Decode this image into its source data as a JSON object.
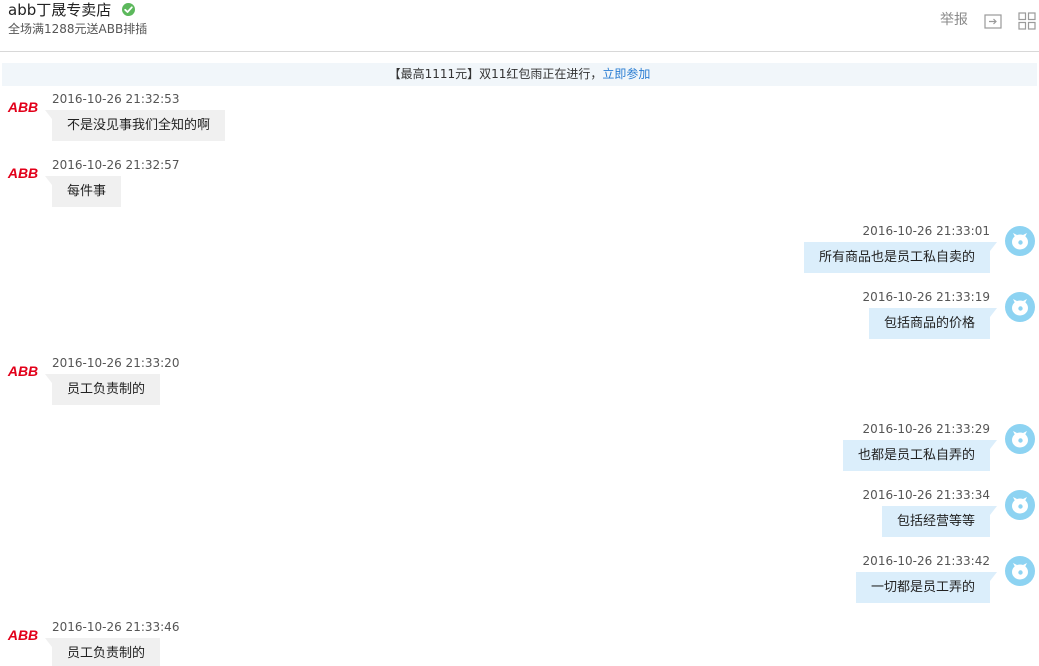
{
  "header": {
    "shop_name": "abb丁晟专卖店",
    "subtitle": "全场满1288元送ABB排插",
    "report_label": "举报",
    "verified_color": "#5cb85c"
  },
  "promo": {
    "text": "【最高1111元】双11红包雨正在进行，",
    "link_text": "立即参加",
    "link_color": "#2a7dd3"
  },
  "seller": {
    "logo_text": "ABB",
    "logo_color": "#e2001a"
  },
  "messages": [
    {
      "side": "in",
      "time": "2016-10-26 21:32:53",
      "text": "不是没见事我们全知的啊"
    },
    {
      "side": "in",
      "time": "2016-10-26 21:32:57",
      "text": "每件事"
    },
    {
      "side": "out",
      "time": "2016-10-26 21:33:01",
      "text": "所有商品也是员工私自卖的"
    },
    {
      "side": "out",
      "time": "2016-10-26 21:33:19",
      "text": "包括商品的价格"
    },
    {
      "side": "in",
      "time": "2016-10-26 21:33:20",
      "text": "员工负责制的"
    },
    {
      "side": "out",
      "time": "2016-10-26 21:33:29",
      "text": "也都是员工私自弄的"
    },
    {
      "side": "out",
      "time": "2016-10-26 21:33:34",
      "text": "包括经营等等"
    },
    {
      "side": "out",
      "time": "2016-10-26 21:33:42",
      "text": "一切都是员工弄的"
    },
    {
      "side": "in",
      "time": "2016-10-26 21:33:46",
      "text": "员工负责制的"
    }
  ]
}
